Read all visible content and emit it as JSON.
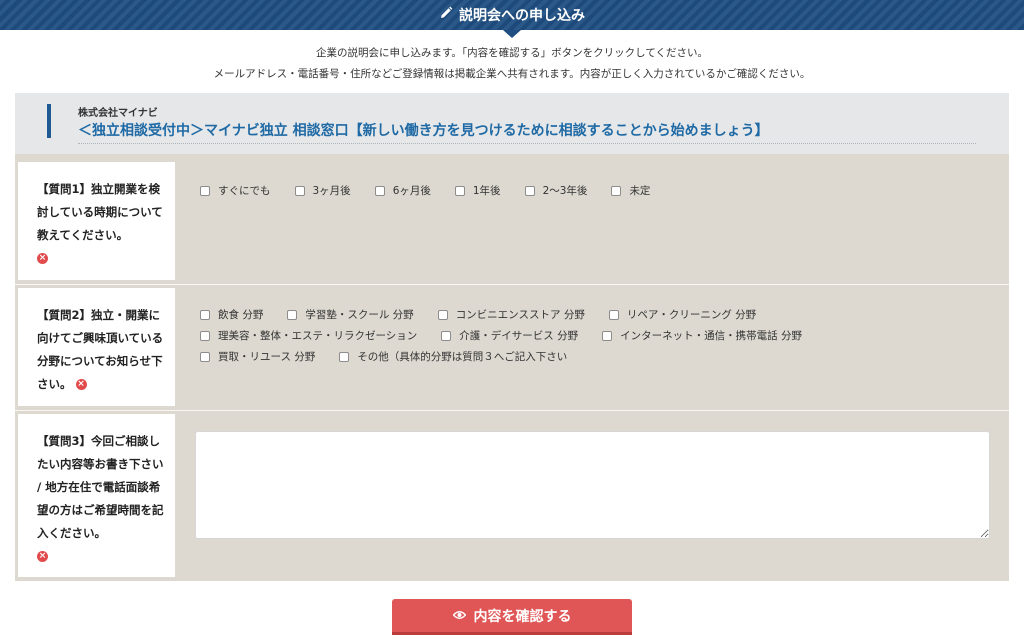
{
  "header": {
    "title": "説明会への申し込み",
    "icon": "pencil-icon"
  },
  "intro": {
    "line1": "企業の説明会に申し込みます。「内容を確認する」ボタンをクリックしてください。",
    "line2": "メールアドレス・電話番号・住所などご登録情報は掲載企業へ共有されます。内容が正しく入力されているかご確認ください。"
  },
  "event": {
    "company": "株式会社マイナビ",
    "title": "＜独立相談受付中＞マイナビ独立 相談窓口【新しい働き方を見つけるために相談することから始めましょう】"
  },
  "questions": {
    "q1": {
      "label": "【質問1】独立開業を検討している時期について教えてください。",
      "options": [
        "すぐにでも",
        "3ヶ月後",
        "6ヶ月後",
        "1年後",
        "2〜3年後",
        "未定"
      ]
    },
    "q2": {
      "label": "【質問2】独立・開業に向けてご興味頂いている分野についてお知らせ下さい。",
      "options": [
        "飲食 分野",
        "学習塾・スクール 分野",
        "コンビニエンスストア 分野",
        "リペア・クリーニング 分野",
        "理美容・整体・エステ・リラクゼーション",
        "介護・デイサービス 分野",
        "インターネット・通信・携帯電話 分野",
        "買取・リユース 分野",
        "その他（具体的分野は質問３へご記入下さい"
      ]
    },
    "q3": {
      "label": "【質問3】今回ご相談したい内容等お書き下さい / 地方在住で電話面談希望の方はご希望時間を記入ください。",
      "value": ""
    }
  },
  "confirm_button": {
    "label": "内容を確認する",
    "icon": "eye-icon"
  },
  "colors": {
    "header": "#1f4f82",
    "accent": "#1f6aa5",
    "required": "#e14b4b",
    "button": "#e05555"
  }
}
